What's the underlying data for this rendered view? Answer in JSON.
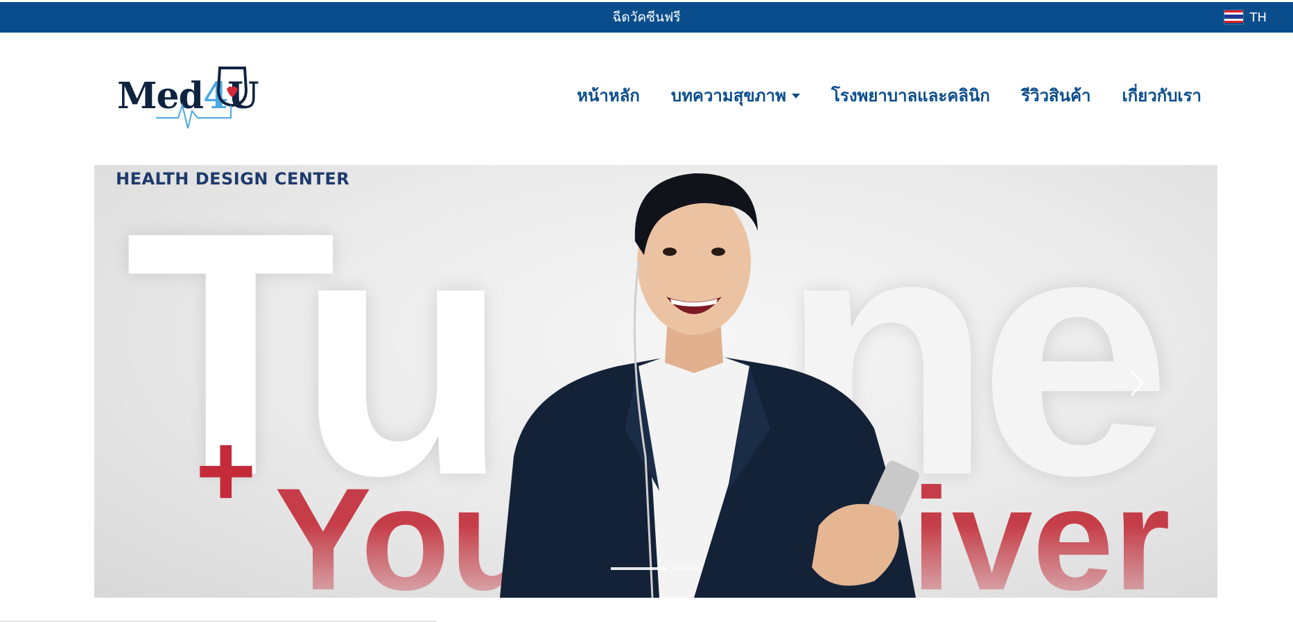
{
  "topbar": {
    "promo": "ฉีดวัคซีนฟรี",
    "language": "TH"
  },
  "logo": {
    "prefix": "Med",
    "number": "4",
    "suffix": "U"
  },
  "nav": {
    "items": [
      {
        "label": "หน้าหลัก"
      },
      {
        "label": "บทความสุขภาพ",
        "has_dropdown": true
      },
      {
        "label": "โรงพยาบาลและคลินิก"
      },
      {
        "label": "รีวิวสินค้า"
      },
      {
        "label": "เกี่ยวกับเรา"
      }
    ]
  },
  "hero": {
    "brand": "HEALTH DESIGN CENTER",
    "big_left": "Tu",
    "big_right": "ne",
    "plus": "+",
    "word_left": "Your",
    "word_right": "Liver",
    "slides": 2,
    "active_slide": 1
  },
  "colors": {
    "primary": "#0a4d8c",
    "accent_red": "#c22b37",
    "logo_dark": "#0f2340",
    "logo_blue": "#4aa8e0"
  }
}
